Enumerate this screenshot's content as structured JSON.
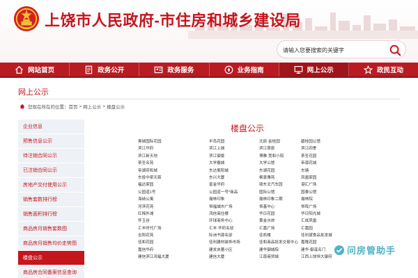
{
  "header": {
    "title": "上饶市人民政府-市住房和城乡建设局",
    "emblem_icon": "national-emblem-icon",
    "search": {
      "placeholder": "请输入您要搜索的关键字",
      "icon": "search-icon"
    }
  },
  "nav": [
    {
      "label": "网站首页",
      "icon": "home-icon"
    },
    {
      "label": "政务公开",
      "icon": "document-icon"
    },
    {
      "label": "政务服务",
      "icon": "service-icon"
    },
    {
      "label": "业务指南",
      "icon": "compass-icon"
    },
    {
      "label": "网上公示",
      "icon": "monitor-icon"
    },
    {
      "label": "政民互动",
      "icon": "star-icon"
    }
  ],
  "section": {
    "title": "网上公示",
    "breadcrumb": {
      "prefix": "您现在所在的位置：",
      "items": [
        "首页",
        "网上公示",
        "楼盘公示"
      ],
      "separator": ">"
    }
  },
  "sidebar": {
    "items": [
      "企业信息",
      "预售信息公示",
      "待注销合同公示",
      "已注销合同公示",
      "房地产交付使用公示",
      "销售套数排行榜",
      "销售面积排行榜",
      "商品房月销售套数图",
      "商品房月销售均价走势图",
      "楼盘公示",
      "商品房合同备案信息查询"
    ],
    "active_index": 9
  },
  "content": {
    "title": "楼盘公示",
    "rows": [
      [
        "奥城国际花园",
        "半岛花园",
        "北辰·金桂园",
        "碧桂园公馆"
      ],
      [
        "滨江华府",
        "滨江上城",
        "滨江首座",
        "滨江四季"
      ],
      [
        "滨江新天地",
        "滨江御景",
        "博雅·宽和小院",
        "茶圣花园"
      ],
      [
        "茶圣名苑",
        "大学春城",
        "大学公馆",
        "帝源花城"
      ],
      [
        "帝湖府和城",
        "东达紫阳城",
        "东湖花园",
        "东塘"
      ],
      [
        "东投中梁天宸",
        "东兴大厦",
        "枫景雅苑",
        "凤凰家园"
      ],
      [
        "福达家园",
        "富金华府",
        "赣东北汽车园",
        "港汇广场"
      ],
      [
        "公园道1号",
        "公园道一号*商品",
        "国际公馆",
        "国泰公馆"
      ],
      [
        "海纳公寓",
        "瀚林印象",
        "瀚林印象二期",
        "瀚林院"
      ],
      [
        "河滨花苑",
        "恒福城市广场",
        "恒基中心",
        "恒晖广场"
      ],
      [
        "红梅外滩",
        "鸿信商住楼",
        "华日花园",
        "华日阳光城"
      ],
      [
        "怀玉谷",
        "环球商务中心",
        "黄金水岸",
        "汇成凤凰"
      ],
      [
        "汇丰时代广场",
        "汇丰·华府名邸",
        "汇嘉广场",
        "汇嘉园"
      ],
      [
        "吉阳花苑",
        "际洲书源名邸",
        "佳凯楼",
        "佳利黛食品批发城"
      ],
      [
        "佳和花园",
        "佳利建材装饰市场",
        "佳和商品批发交易中心",
        "嘉隆花园"
      ],
      [
        "嘉信华府",
        "建发央著小区",
        "建华御城院",
        "建华·御溪名门"
      ],
      [
        "建信滨江鸿福大厦",
        "建信大厦",
        "江南商贸城",
        "江西上饶恒大御府"
      ]
    ]
  },
  "watermark": {
    "text": "问房管助手",
    "icon": "badge-icon"
  },
  "colors": {
    "accent": "#c4161c",
    "nav_bg": "#b81c22",
    "sidebar_bg": "#eef1f5",
    "watermark": "#4fb3c7"
  }
}
